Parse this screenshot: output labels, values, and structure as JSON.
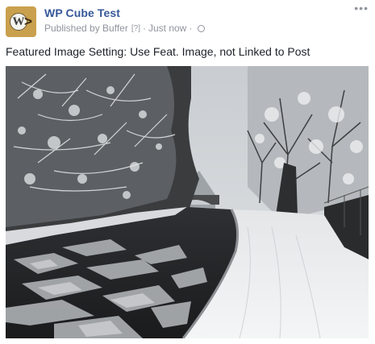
{
  "post": {
    "page_name": "WP Cube Test",
    "published_by": "Published by Buffer",
    "help_marker": "[?]",
    "separator": "·",
    "timestamp": "Just now",
    "more_glyph": "•••",
    "text": "Featured Image Setting: Use Feat. Image, not Linked to Post"
  },
  "avatar": {
    "letter": "W",
    "chevron": ">"
  },
  "colors": {
    "page_name": "#365899",
    "meta_text": "#90949c",
    "body_text": "#1d2129",
    "avatar_bg": "#c9a04d"
  },
  "icons": {
    "privacy": "globe-icon",
    "menu": "more-options-icon"
  }
}
